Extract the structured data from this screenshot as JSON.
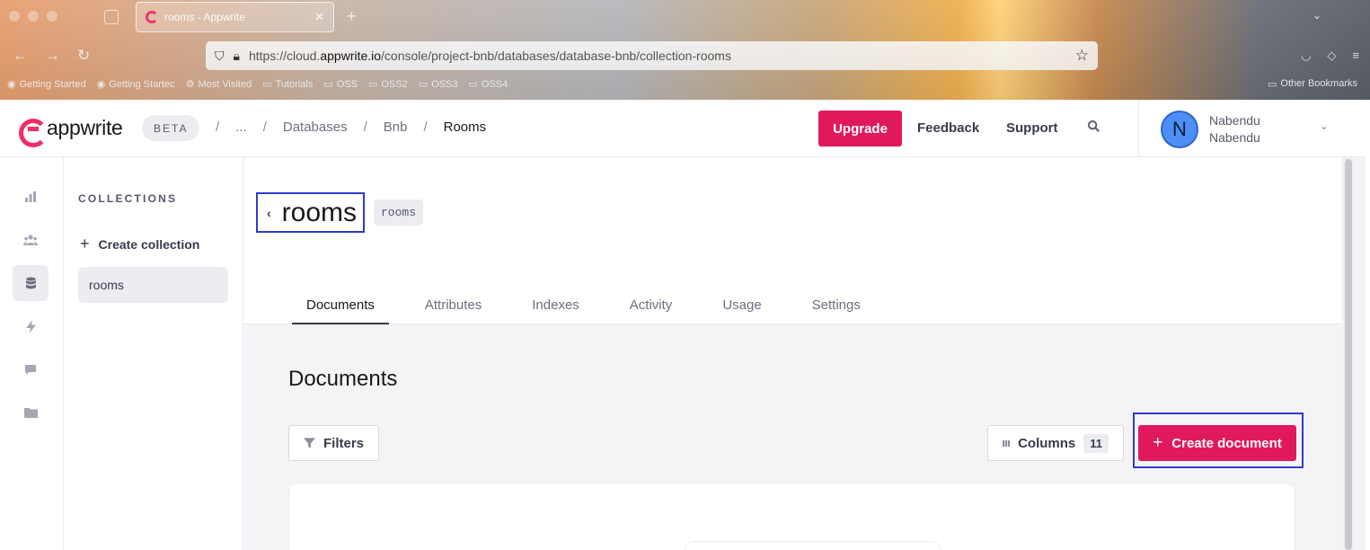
{
  "browser": {
    "tab_title": "rooms - Appwrite",
    "tab_close": "✕",
    "new_tab": "+",
    "tab_list": "⌄",
    "back": "←",
    "forward": "→",
    "reload": "↻",
    "url_prefix": "https://cloud.",
    "url_domain": "appwrite.io",
    "url_path": "/console/project-bnb/databases/database-bnb/collection-rooms",
    "bookmarks": [
      {
        "label": "Getting Started",
        "icon": "firefox-icon"
      },
      {
        "label": "Getting Startec",
        "icon": "firefox-icon"
      },
      {
        "label": "Most Visited",
        "icon": "gear-icon"
      },
      {
        "label": "Tutorials",
        "icon": "folder-icon"
      },
      {
        "label": "OSS",
        "icon": "folder-icon"
      },
      {
        "label": "OSS2",
        "icon": "folder-icon"
      },
      {
        "label": "OSS3",
        "icon": "folder-icon"
      },
      {
        "label": "OSS4",
        "icon": "folder-icon"
      }
    ],
    "other_bookmarks": "Other Bookmarks"
  },
  "header": {
    "logo_text": "appwrite",
    "badge": "BETA",
    "breadcrumbs": [
      "...",
      "Databases",
      "Bnb",
      "Rooms"
    ],
    "upgrade": "Upgrade",
    "feedback": "Feedback",
    "support": "Support",
    "user": {
      "initial": "N",
      "name": "Nabendu",
      "subtitle": "Nabendu"
    }
  },
  "rail": [
    "chart-icon",
    "users-icon",
    "database-icon",
    "bolt-icon",
    "message-icon",
    "folder-icon"
  ],
  "collections": {
    "heading": "COLLECTIONS",
    "create": "Create collection",
    "items": [
      "rooms"
    ]
  },
  "collection": {
    "title": "rooms",
    "id": "rooms",
    "tabs": [
      "Documents",
      "Attributes",
      "Indexes",
      "Activity",
      "Usage",
      "Settings"
    ],
    "active_tab": "Documents"
  },
  "documents": {
    "heading": "Documents",
    "filters": "Filters",
    "columns": "Columns",
    "columns_count": "11",
    "create": "Create document"
  },
  "colors": {
    "accent": "#e0185e",
    "highlight": "#2e3bc9"
  }
}
